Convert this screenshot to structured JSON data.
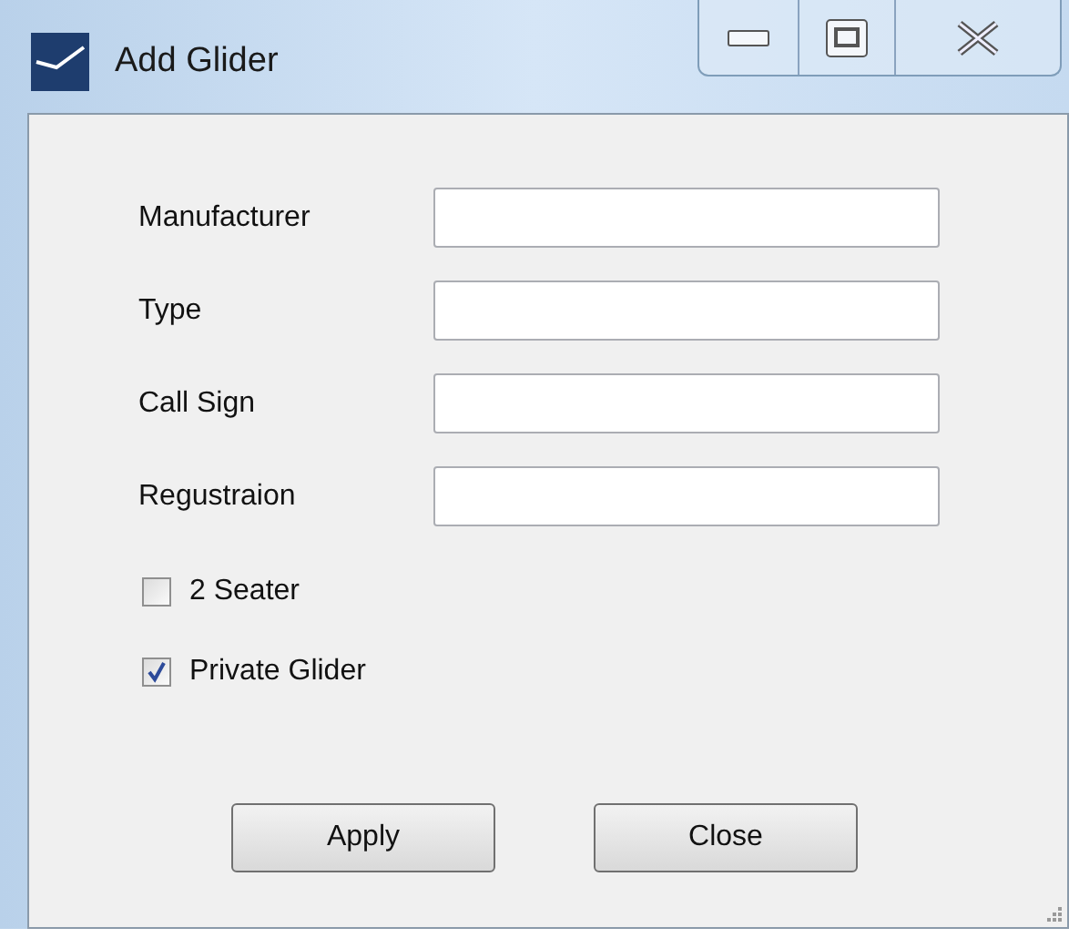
{
  "window": {
    "title": "Add Glider"
  },
  "fields": [
    {
      "label": "Manufacturer"
    },
    {
      "label": "Type"
    },
    {
      "label": "Call Sign"
    },
    {
      "label": "Regustraion"
    }
  ],
  "checkboxes": [
    {
      "label": "2 Seater",
      "checked": false
    },
    {
      "label": "Private Glider",
      "checked": true
    }
  ],
  "buttons": [
    "Apply",
    "Close"
  ]
}
